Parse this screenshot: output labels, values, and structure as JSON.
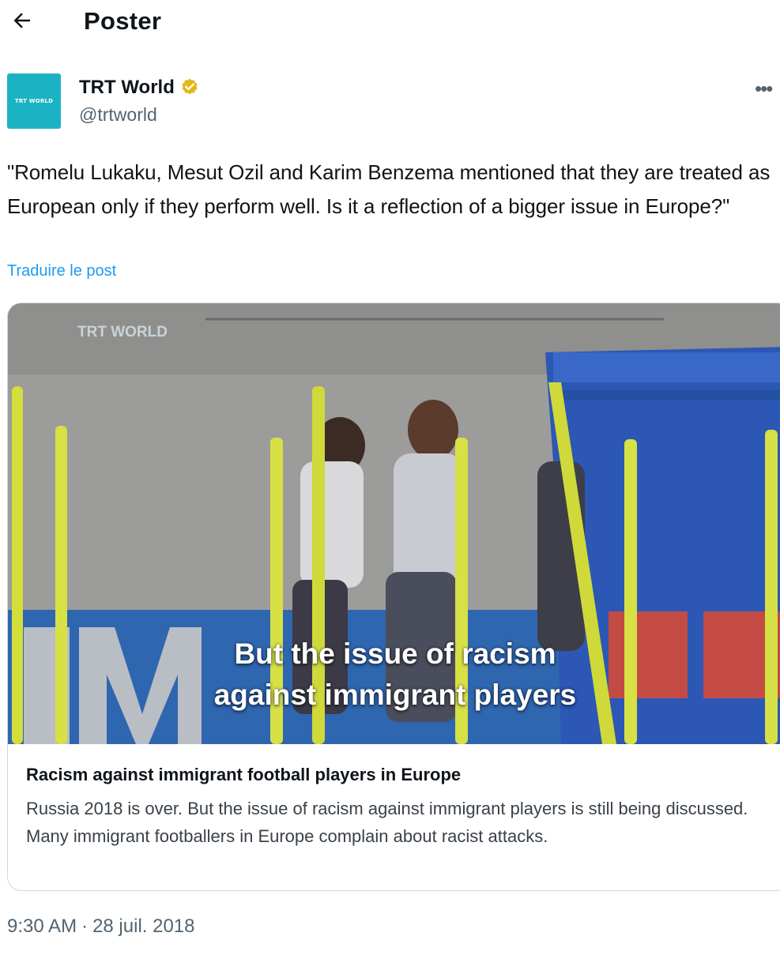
{
  "header": {
    "title": "Poster",
    "back_icon": "arrow-left-icon"
  },
  "author": {
    "name": "TRT World",
    "handle": "@trtworld",
    "avatar_text": "TRT WORLD",
    "avatar_color": "#1bb3c4",
    "verified_icon": "verified-gold-badge-icon",
    "verified_color": "#e2b719"
  },
  "post": {
    "text": "\"Romelu Lukaku, Mesut Ozil and Karim Benzema mentioned that they are treated as European only if they perform well. Is it a reflection of a bigger issue in Europe?\"",
    "translate_label": "Traduire le post",
    "more_icon": "more-dots-icon"
  },
  "card": {
    "video_watermark": "TRT WORLD",
    "caption_line1": "But the issue of racism",
    "caption_line2": "against immigrant players",
    "title": "Racism against immigrant football players in Europe",
    "description": "Russia 2018 is over. But the issue of racism against immigrant players is still being discussed. Many immigrant footballers in Europe complain about racist attacks."
  },
  "meta": {
    "time": "9:30 AM",
    "separator": "·",
    "date": "28 juil. 2018"
  },
  "colors": {
    "accent": "#1d9bf0",
    "secondary_text": "#536471",
    "border": "#cfd9de"
  }
}
